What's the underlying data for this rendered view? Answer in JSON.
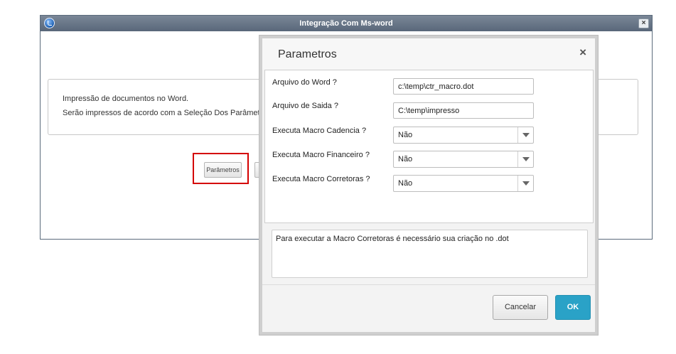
{
  "main_window": {
    "title": "Integração Com Ms-word",
    "close_glyph": "×",
    "info_lines": [
      "Impressão de documentos no Word.",
      "Serão impressos de acordo com a Seleção Dos Parâmetros"
    ],
    "buttons": {
      "parametros": "Parâmetros"
    }
  },
  "dialog": {
    "title": "Parametros",
    "close_glyph": "×",
    "fields": [
      {
        "label": "Arquivo do Word ?",
        "value": "c:\\temp\\ctr_macro.dot",
        "type": "text"
      },
      {
        "label": "Arquivo de Saida ?",
        "value": "C:\\temp\\impresso",
        "type": "text"
      },
      {
        "label": "Executa Macro Cadencia ?",
        "value": "Não",
        "type": "select"
      },
      {
        "label": "Executa Macro Financeiro ?",
        "value": "Não",
        "type": "select"
      },
      {
        "label": "Executa Macro Corretoras ?",
        "value": "Não",
        "type": "select"
      }
    ],
    "help_text": "Para executar a Macro Corretoras é necessário sua criação no .dot",
    "buttons": {
      "cancel": "Cancelar",
      "ok": "OK"
    }
  },
  "icons": {
    "app": "app-logo-icon",
    "close": "close-icon",
    "dropdown": "chevron-down-icon"
  },
  "colors": {
    "titlebar": "#6b7889",
    "highlight": "#d40000",
    "ok_button": "#2aa2c7"
  }
}
